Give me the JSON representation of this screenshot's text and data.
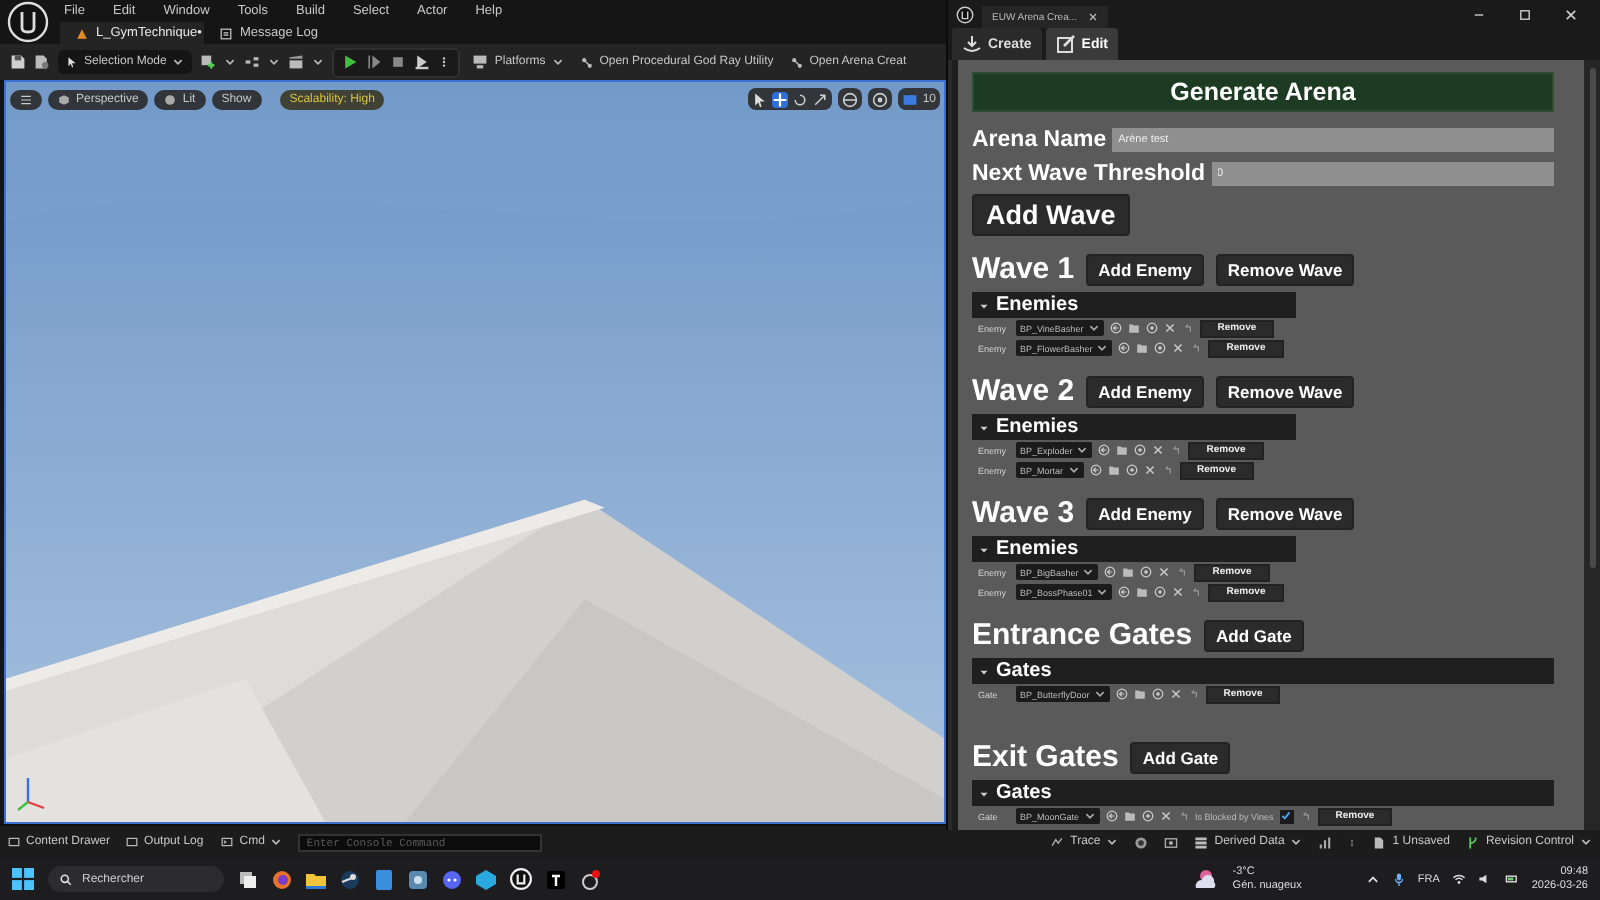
{
  "menu": [
    "File",
    "Edit",
    "Window",
    "Tools",
    "Build",
    "Select",
    "Actor",
    "Help"
  ],
  "doc_tabs": [
    {
      "label": "L_GymTechnique•",
      "selected": true
    },
    {
      "label": "Message Log",
      "selected": false
    }
  ],
  "toolbar": {
    "mode": "Selection Mode",
    "platforms": "Platforms",
    "utilities": [
      "Open Procedural God Ray Utility",
      "Open Arena Creat"
    ]
  },
  "viewport": {
    "perspective": "Perspective",
    "lighting": "Lit",
    "show": "Show",
    "scalability": "Scalability: High",
    "camera_speed": "10"
  },
  "status_bar": {
    "left": [
      "Content Drawer",
      "Output Log"
    ],
    "cmd": "Cmd",
    "console_placeholder": "Enter Console Command",
    "trace": "Trace",
    "derived_data": "Derived Data",
    "unsaved": "1 Unsaved",
    "revision_control": "Revision Control"
  },
  "panel": {
    "title": "EUW Arena Crea...",
    "tabs": [
      {
        "label": "Create",
        "selected": false
      },
      {
        "label": "Edit",
        "selected": true
      }
    ],
    "generate_button": "Generate Arena",
    "fields": [
      {
        "label": "Arena Name",
        "value": "Arène test"
      },
      {
        "label": "Next Wave Threshold",
        "value": "0"
      }
    ],
    "add_wave_button": "Add Wave",
    "sections": [
      {
        "kind": "wave",
        "title": "Wave 1",
        "add_button": "Add Enemy",
        "remove_button": "Remove Wave",
        "list": {
          "title": "Enemies",
          "expanded": true,
          "rows": [
            {
              "label": "Enemy",
              "asset": "BP_VineBasher",
              "remove": "Remove"
            },
            {
              "label": "Enemy",
              "asset": "BP_FlowerBasher",
              "remove": "Remove"
            }
          ]
        }
      },
      {
        "kind": "wave",
        "title": "Wave 2",
        "add_button": "Add Enemy",
        "remove_button": "Remove Wave",
        "list": {
          "title": "Enemies",
          "expanded": true,
          "rows": [
            {
              "label": "Enemy",
              "asset": "BP_Exploder",
              "remove": "Remove"
            },
            {
              "label": "Enemy",
              "asset": "BP_Mortar",
              "remove": "Remove"
            }
          ]
        }
      },
      {
        "kind": "wave",
        "title": "Wave 3",
        "add_button": "Add Enemy",
        "remove_button": "Remove Wave",
        "list": {
          "title": "Enemies",
          "expanded": true,
          "rows": [
            {
              "label": "Enemy",
              "asset": "BP_BigBasher",
              "remove": "Remove"
            },
            {
              "label": "Enemy",
              "asset": "BP_BossPhase01",
              "remove": "Remove"
            }
          ]
        }
      },
      {
        "kind": "gates",
        "title": "Entrance Gates",
        "add_button": "Add Gate",
        "list": {
          "title": "Gates",
          "expanded": true,
          "rows": [
            {
              "label": "Gate",
              "asset": "BP_ButterflyDoor",
              "remove": "Remove"
            }
          ]
        }
      },
      {
        "kind": "gates",
        "title": "Exit Gates",
        "add_button": "Add Gate",
        "list": {
          "title": "Gates",
          "expanded": true,
          "rows": [
            {
              "label": "Gate",
              "asset": "BP_MoonGate",
              "option": "Is Blocked by Vines",
              "checked": true,
              "remove": "Remove"
            }
          ]
        }
      }
    ]
  },
  "taskbar": {
    "search_placeholder": "Rechercher",
    "temperature": "-3°C",
    "weather": "Gén. nuageux",
    "language": "FRA",
    "time": "09:48",
    "date": "2026-03-26"
  }
}
